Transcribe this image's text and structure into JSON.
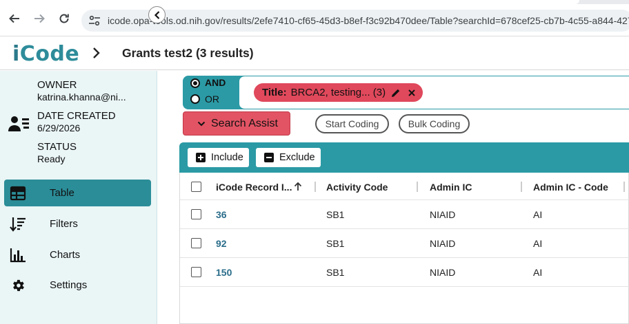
{
  "browser": {
    "url": "icode.opa-tools.od.nih.gov/results/2efe7410-cf65-45d3-b8ef-f3c92b470dee/Table?searchId=678cef25-cb7b-4c55-a844-427",
    "back_icon": "arrow-left-icon",
    "forward_icon": "arrow-right-icon",
    "reload_icon": "reload-icon",
    "site_info_icon": "tune-icon"
  },
  "header": {
    "logo_first": "i",
    "logo_rest": "Code",
    "title": "Grants test2 (3 results)"
  },
  "sidebar": {
    "owner_label": "OWNER",
    "owner_value": "katrina.khanna@ni...",
    "created_label": "DATE CREATED",
    "created_value": "6/29/2026",
    "status_label": "STATUS",
    "status_value": "Ready",
    "items": [
      {
        "label": "Table",
        "icon": "table-icon",
        "active": true
      },
      {
        "label": "Filters",
        "icon": "sort-filter-icon",
        "active": false
      },
      {
        "label": "Charts",
        "icon": "bar-chart-icon",
        "active": false
      },
      {
        "label": "Settings",
        "icon": "gear-icon",
        "active": false
      }
    ]
  },
  "query": {
    "and_label": "AND",
    "or_label": "OR",
    "selected": "AND",
    "chip_key": "Title:",
    "chip_value": "BRCA2, testing... (3)",
    "search_assist_label": "Search Assist",
    "start_coding_label": "Start Coding",
    "bulk_coding_label": "Bulk Coding"
  },
  "toolbar": {
    "include_label": "Include",
    "exclude_label": "Exclude"
  },
  "table": {
    "columns": [
      "iCode Record I...",
      "Activity Code",
      "Admin IC",
      "Admin IC - Code"
    ],
    "rows": [
      {
        "id": "36",
        "activity": "SB1",
        "admin_ic": "NIAID",
        "admin_code": "AI"
      },
      {
        "id": "92",
        "activity": "SB1",
        "admin_ic": "NIAID",
        "admin_code": "AI"
      },
      {
        "id": "150",
        "activity": "SB1",
        "admin_ic": "NIAID",
        "admin_code": "AI"
      }
    ]
  },
  "colors": {
    "accent": "#2b9aa5",
    "active_nav": "#2b8d98",
    "chip": "#e0485b",
    "search_assist": "#e25464",
    "sidebar_bg": "#eaf5f6",
    "link": "#2a6d8a"
  }
}
